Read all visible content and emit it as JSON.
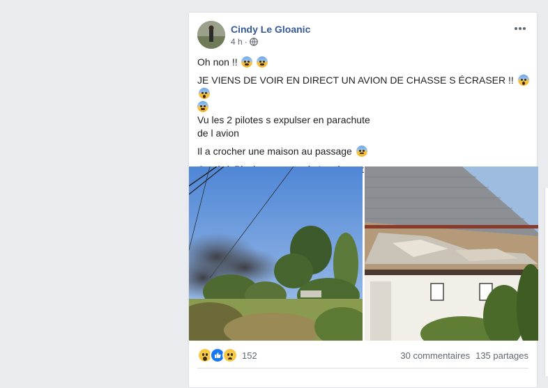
{
  "post": {
    "author": "Cindy Le Gloanic",
    "time": "4 h",
    "separator": "·",
    "audience_icon": "globe-icon",
    "more_icon": "more-options-icon",
    "lines": [
      "Oh non !!",
      "JE VIENS DE VOIR EN DIRECT UN AVION DE CHASSE S ÉCRASER !!",
      "Vu les 2 pilotes s expulser en parachute",
      "de l avion",
      "Il a crocher une maison au passage",
      "Crash à Pluvigner, route de Landevant."
    ],
    "emojis": {
      "line1": [
        "grimace-emoji",
        "grimace-emoji"
      ],
      "line2": [
        "scream-emoji",
        "scream-emoji",
        "grimace-emoji"
      ],
      "line5": [
        "fearful-emoji"
      ]
    },
    "photos": [
      "smoke-over-trees-photo",
      "damaged-house-roof-photo"
    ]
  },
  "engagement": {
    "reactions": [
      "wow-reaction-icon",
      "like-reaction-icon",
      "sad-reaction-icon"
    ],
    "reaction_count": "152",
    "comments": "30 commentaires",
    "shares": "135 partages"
  },
  "colors": {
    "page_bg": "#e9ebee",
    "card_bg": "#ffffff",
    "author_link": "#365899",
    "text": "#1c1e21",
    "meta": "#616770",
    "like_blue": "#1877f2"
  }
}
